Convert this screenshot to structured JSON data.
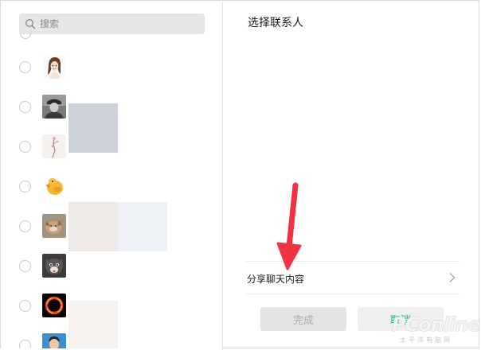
{
  "search": {
    "placeholder": "搜索",
    "value": ""
  },
  "contacts": [
    {
      "avatar": "woman-cartoon-avatar"
    },
    {
      "avatar": "soldier-photo-avatar"
    },
    {
      "avatar": "flower-branch-avatar"
    },
    {
      "avatar": "duck-sticker-avatar"
    },
    {
      "avatar": "fox-photo-avatar"
    },
    {
      "avatar": "cat-photo-avatar"
    },
    {
      "avatar": "black-hole-avatar"
    },
    {
      "avatar": "man-photo-avatar"
    }
  ],
  "panel": {
    "title": "选择联系人",
    "share_label": "分享聊天内容"
  },
  "buttons": {
    "done": "完成",
    "cancel": "取消"
  },
  "watermark": {
    "logo": "PConline",
    "sub": "太平洋电脑网"
  },
  "colors": {
    "accent": "#07c160",
    "annotation_arrow": "#ef3340"
  }
}
